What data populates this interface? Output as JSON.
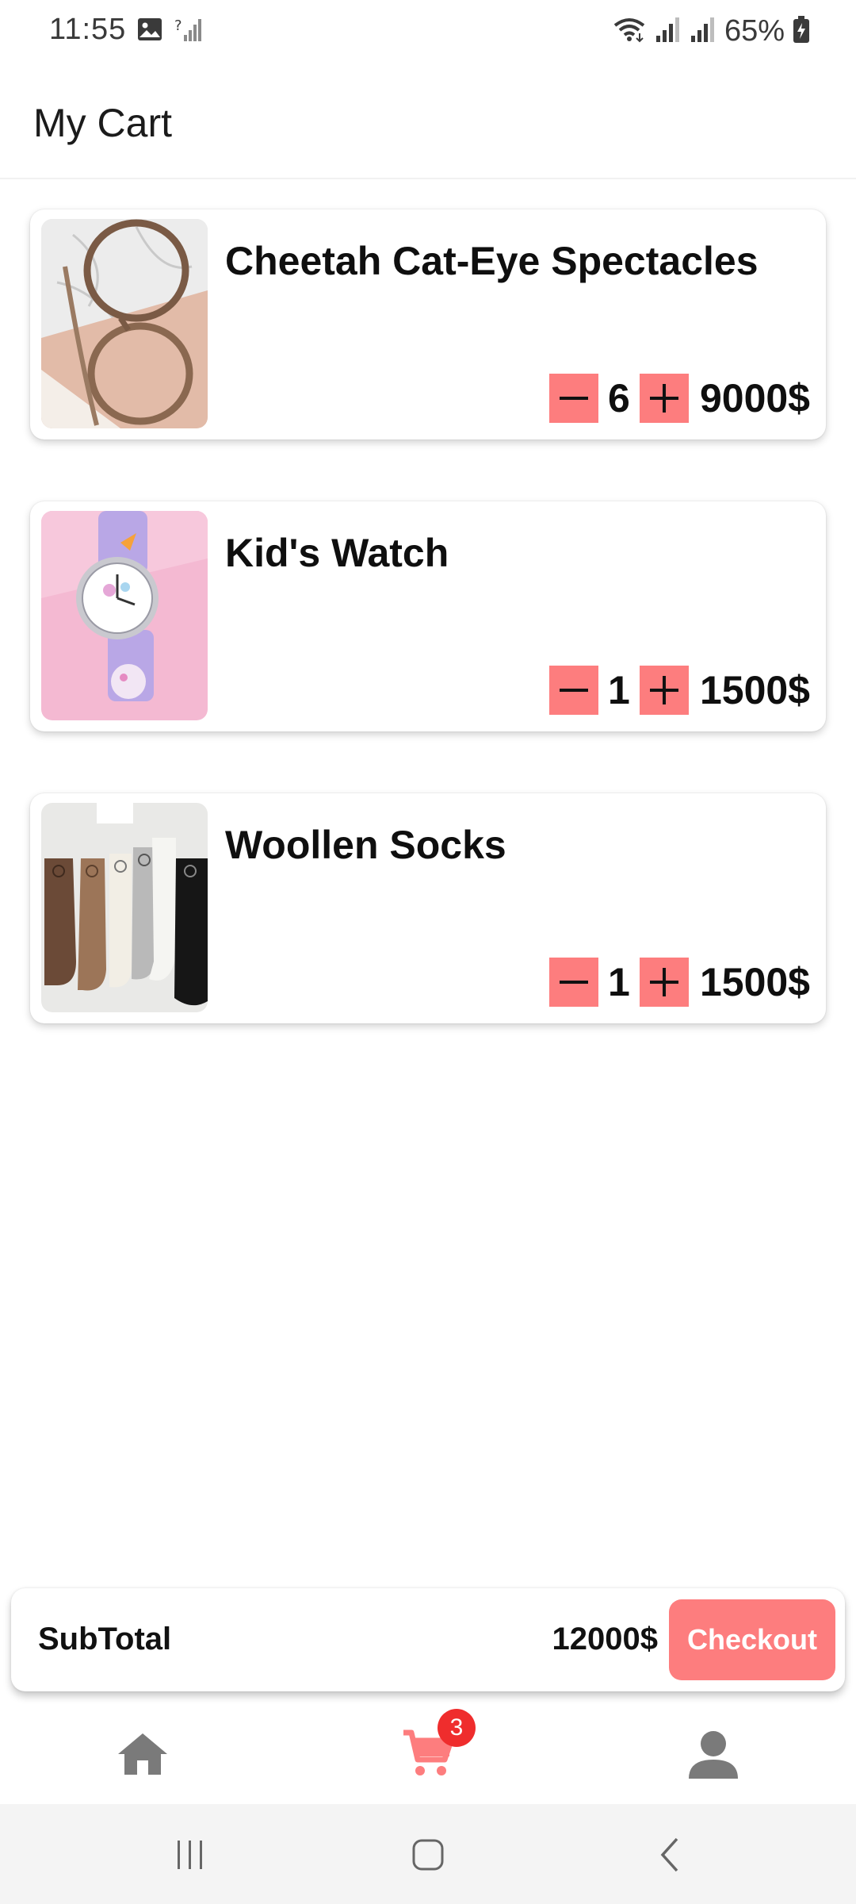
{
  "status_bar": {
    "time": "11:55",
    "battery": "65%",
    "icons": [
      "image-icon",
      "no-sim-signal-icon",
      "wifi-icon",
      "signal-icon",
      "signal-icon",
      "battery-charging-icon"
    ]
  },
  "header": {
    "title": "My Cart"
  },
  "cart": {
    "items": [
      {
        "name": "Cheetah Cat-Eye Spectacles",
        "quantity": "6",
        "price": "9000$",
        "image": "spectacles-photo"
      },
      {
        "name": "Kid's Watch",
        "quantity": "1",
        "price": "1500$",
        "image": "kids-watch-photo"
      },
      {
        "name": "Woollen Socks",
        "quantity": "1",
        "price": "1500$",
        "image": "woollen-socks-photo"
      }
    ],
    "decrement_icon": "minus-icon",
    "increment_icon": "plus-icon"
  },
  "summary": {
    "subtotal_label": "SubTotal",
    "subtotal_value": "12000$",
    "checkout_label": "Checkout"
  },
  "bottom_nav": {
    "items": [
      {
        "name": "home",
        "icon": "home-icon"
      },
      {
        "name": "cart",
        "icon": "cart-icon",
        "badge": "3",
        "active": true
      },
      {
        "name": "profile",
        "icon": "person-icon"
      }
    ]
  },
  "system_nav": {
    "icons": [
      "recents-icon",
      "home-square-icon",
      "back-icon"
    ]
  },
  "colors": {
    "accent": "#fd7d7e",
    "badge": "#ef2d2d",
    "nav_inactive": "#7a7a7a",
    "text": "#0f0f0f"
  }
}
